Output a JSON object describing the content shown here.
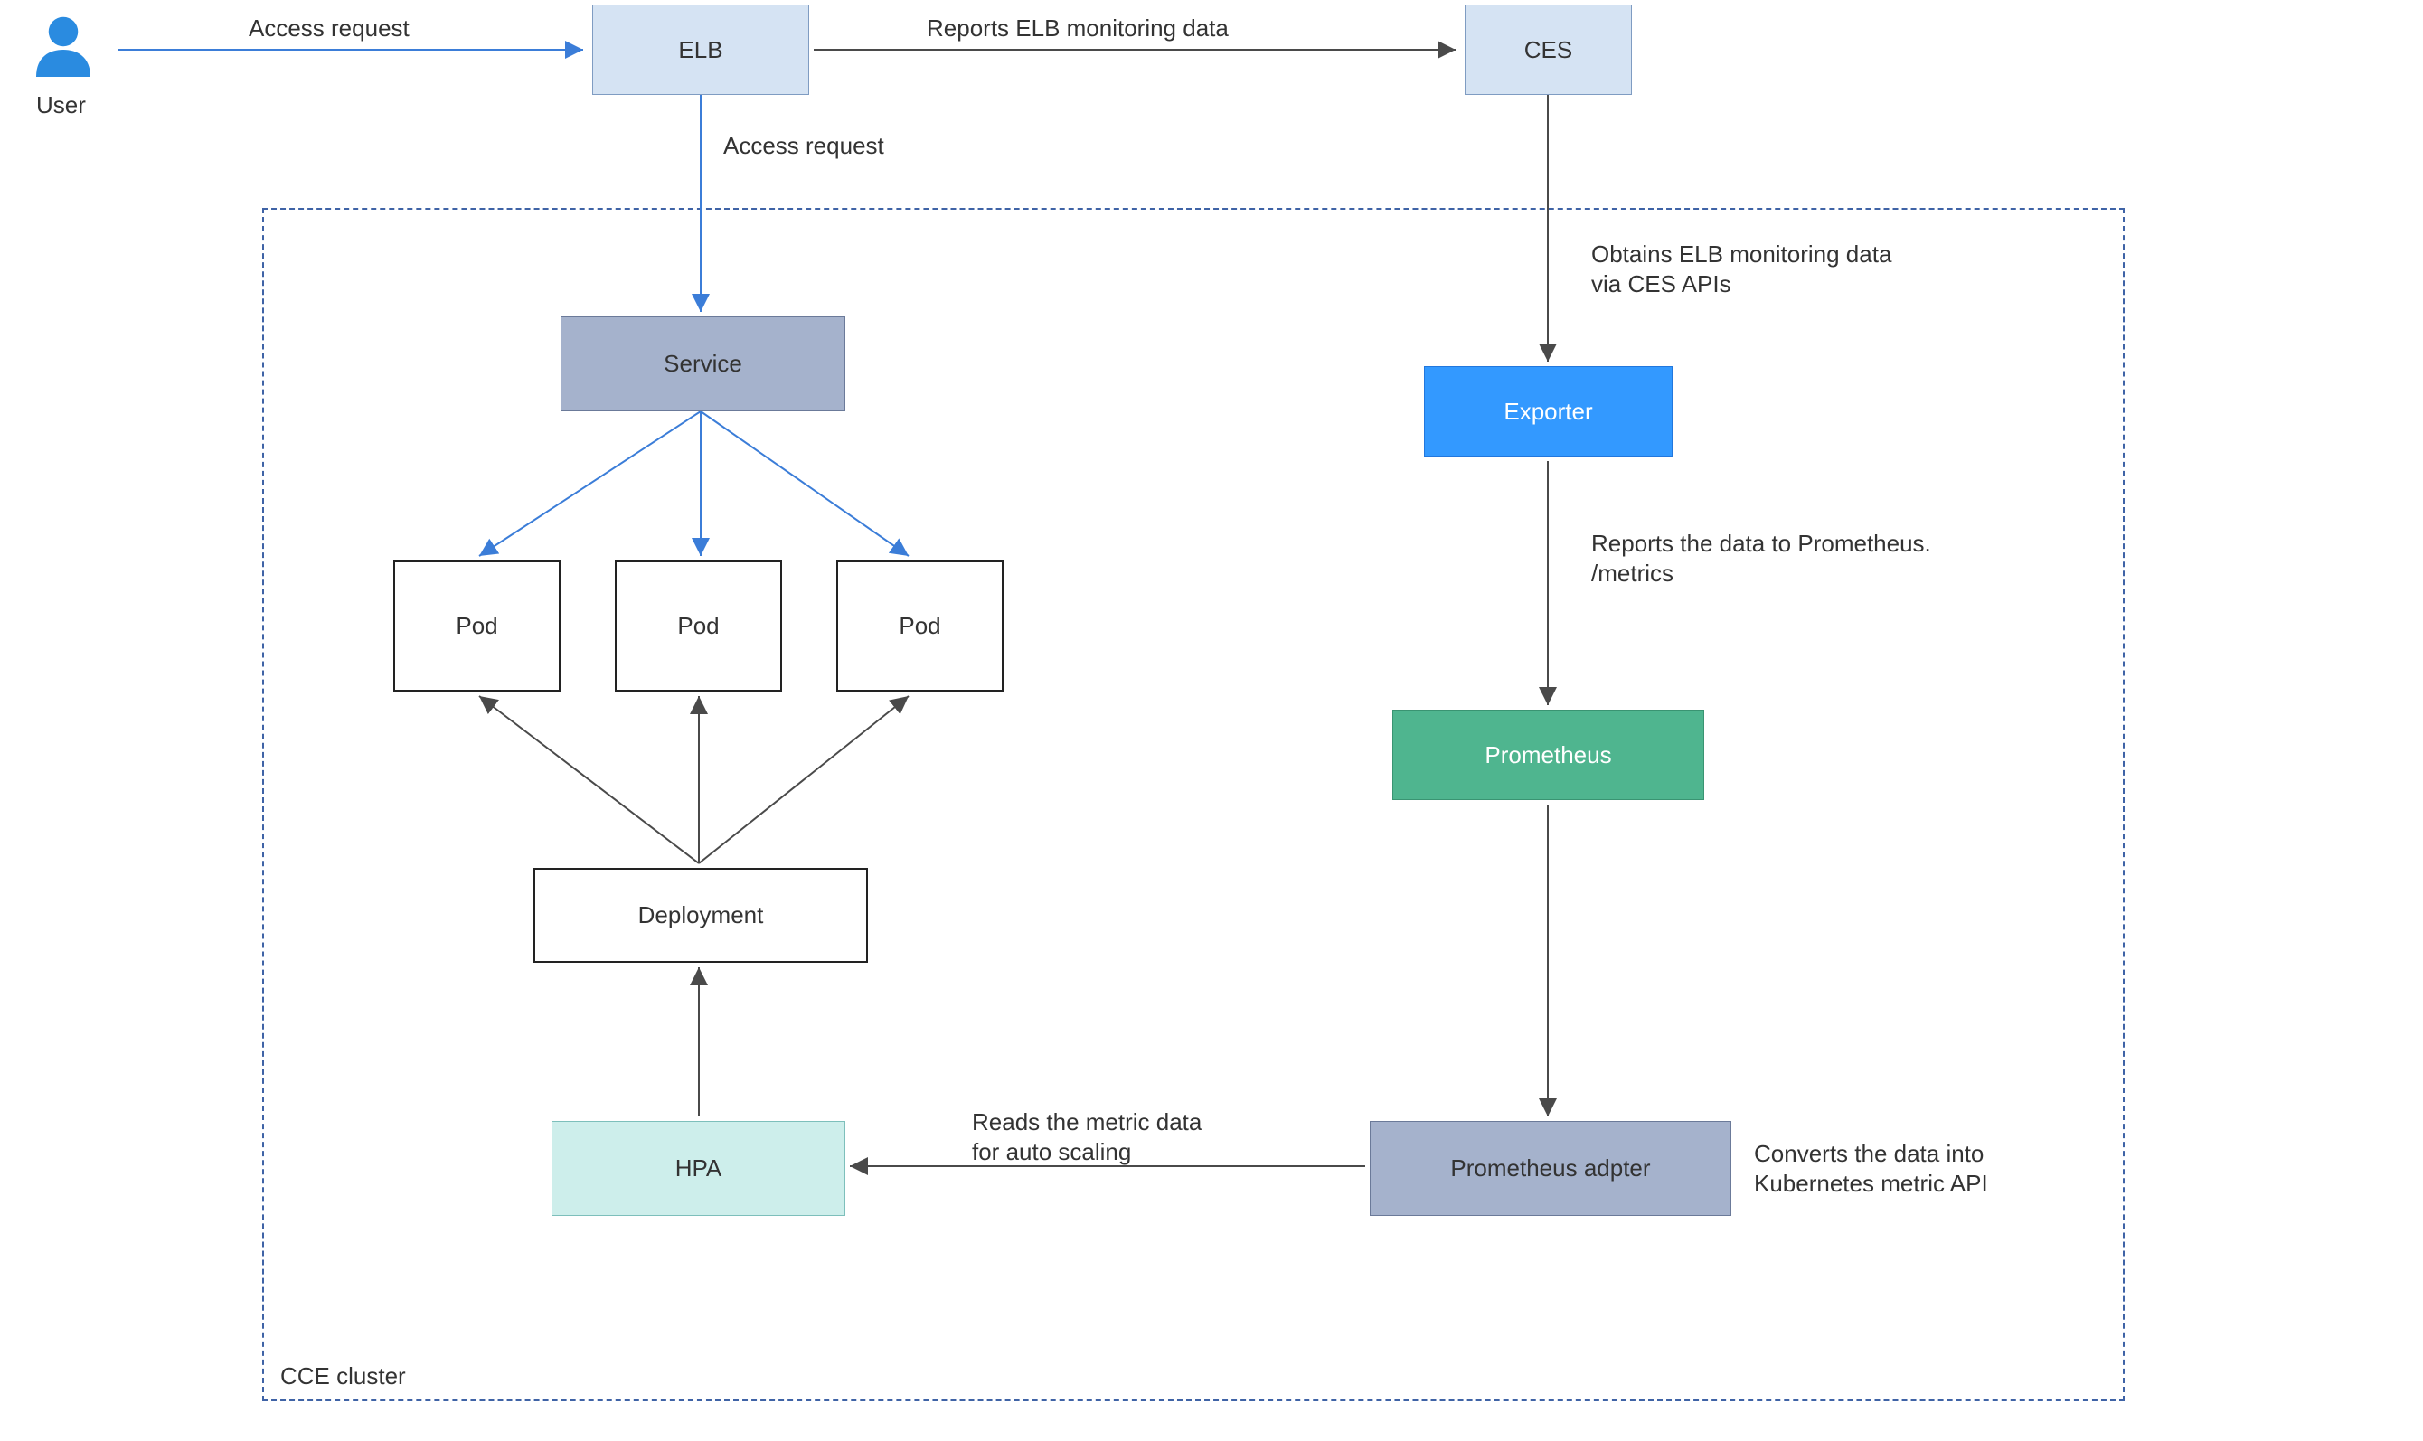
{
  "user": {
    "label": "User"
  },
  "edges": {
    "user_elb": "Access request",
    "elb_ces": "Reports ELB monitoring data",
    "elb_service": "Access request",
    "ces_exporter": "Obtains ELB monitoring data\nvia CES APIs",
    "exporter_prom": "Reports the data to Prometheus.\n/metrics",
    "adapter_annot": "Converts the data into\nKubernetes metric API",
    "adapter_hpa": "Reads the metric data\nfor auto scaling"
  },
  "nodes": {
    "elb": "ELB",
    "ces": "CES",
    "service": "Service",
    "pod": "Pod",
    "deployment": "Deployment",
    "hpa": "HPA",
    "exporter": "Exporter",
    "prometheus": "Prometheus",
    "adapter": "Prometheus adpter"
  },
  "cluster": {
    "label": "CCE cluster"
  }
}
